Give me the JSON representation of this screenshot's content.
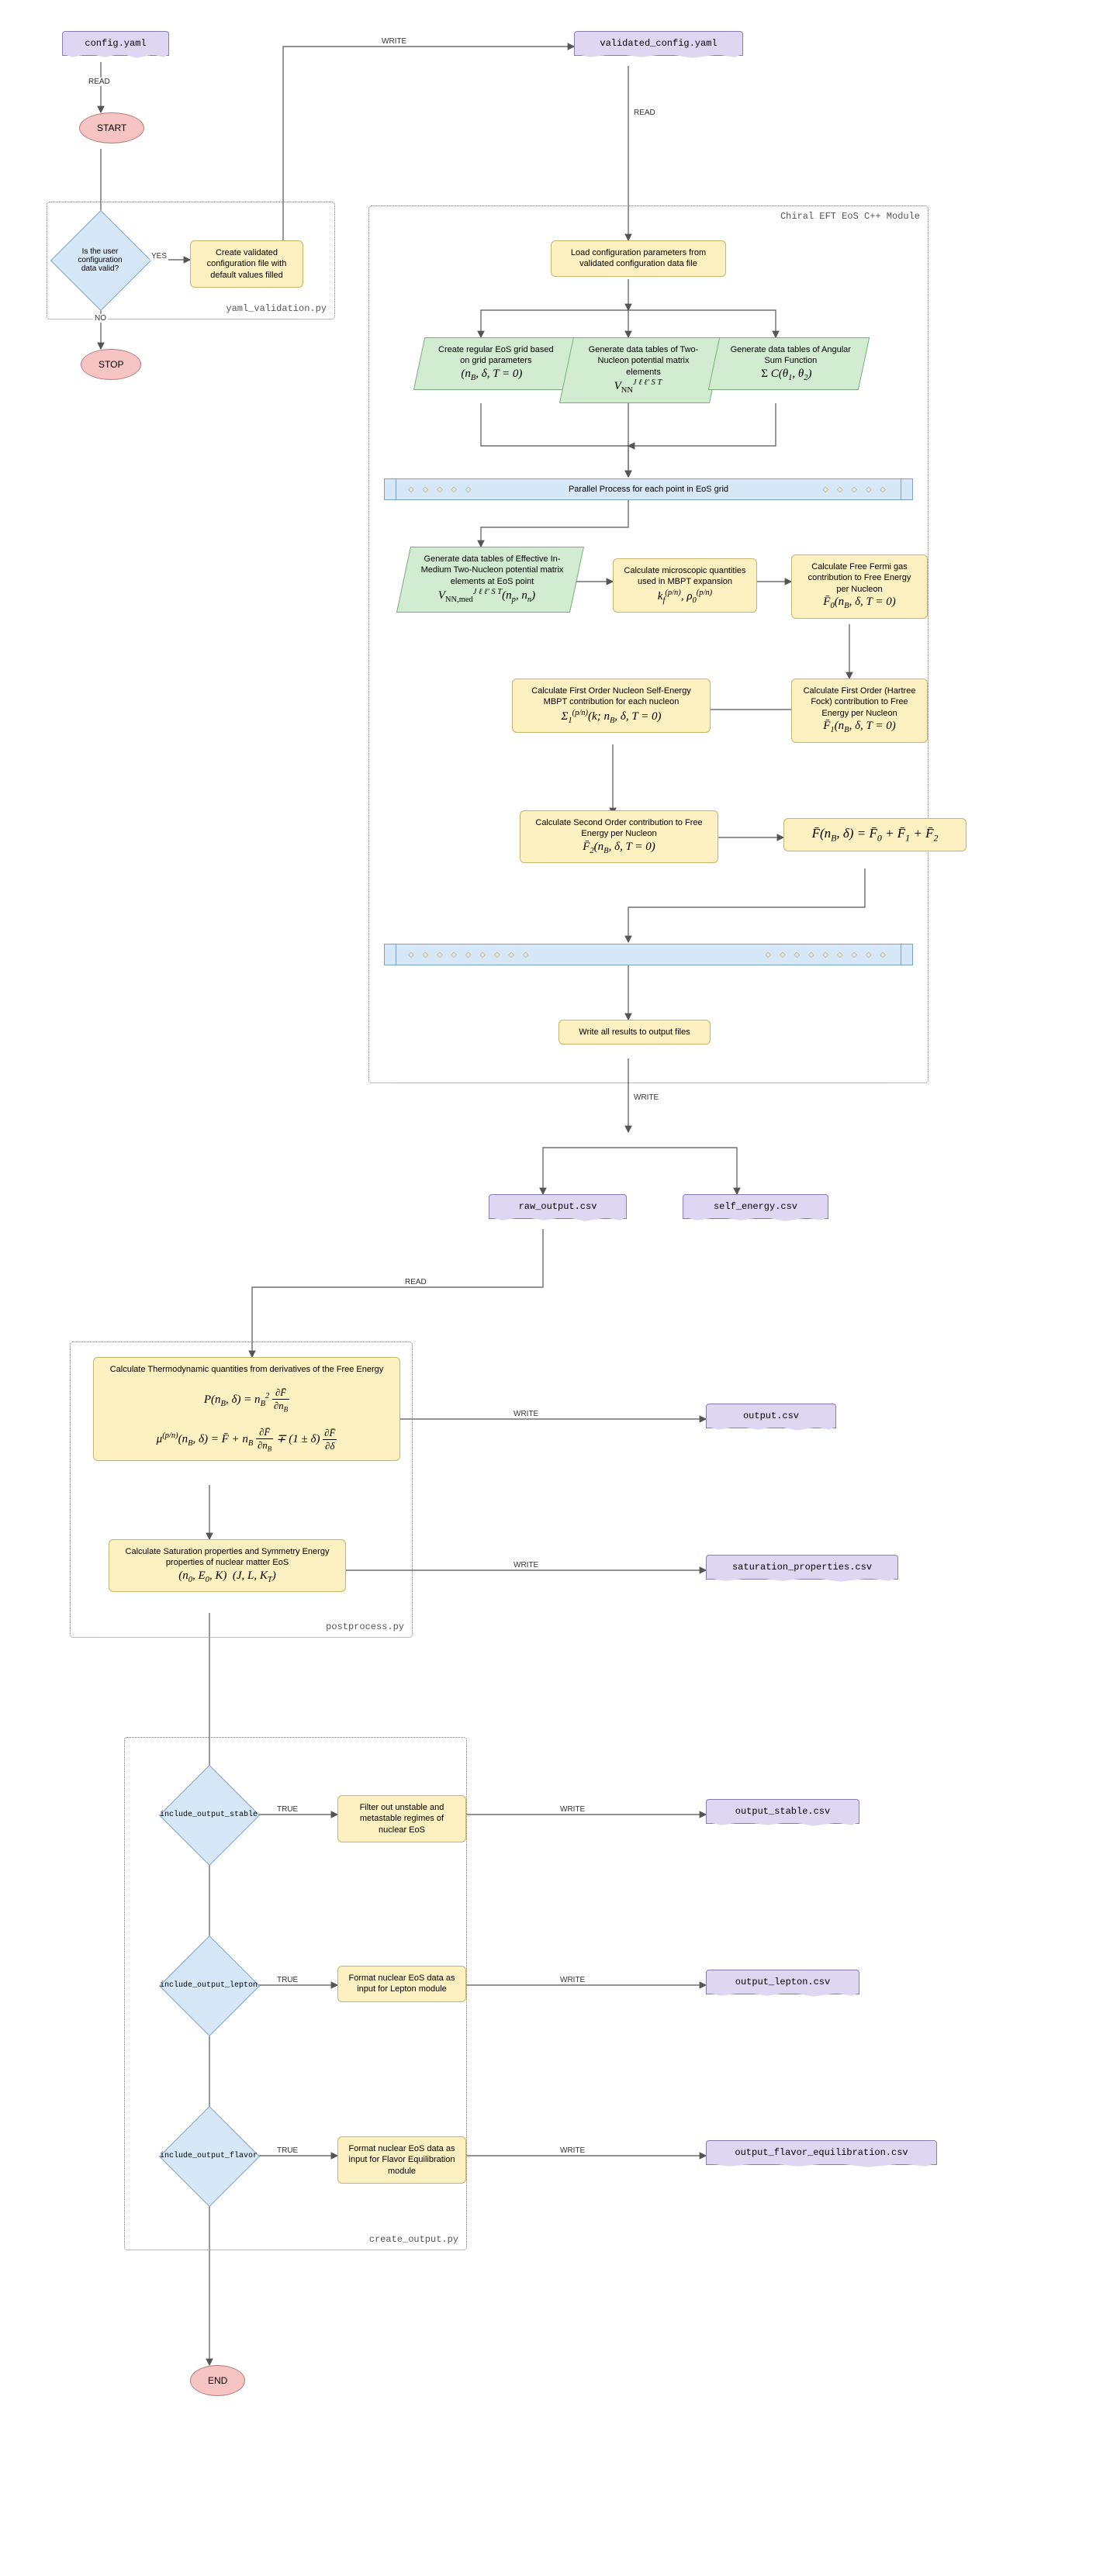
{
  "modules": {
    "yaml_validation": "yaml_validation.py",
    "chiral": "Chiral EFT EoS C++ Module",
    "postprocess": "postprocess.py",
    "create_output": "create_output.py"
  },
  "files": {
    "config": "config.yaml",
    "validated": "validated_config.yaml",
    "raw_output": "raw_output.csv",
    "self_energy": "self_energy.csv",
    "output": "output.csv",
    "saturation": "saturation_properties.csv",
    "output_stable": "output_stable.csv",
    "output_lepton": "output_lepton.csv",
    "output_flavor": "output_flavor_equilibration.csv"
  },
  "terminals": {
    "start": "START",
    "stop": "STOP",
    "end": "END"
  },
  "decisions": {
    "valid": "Is the user configuration data valid?",
    "inc_stable": "include_output_stable",
    "inc_lepton": "include_output_lepton",
    "inc_flavor": "include_output_flavor"
  },
  "processes": {
    "create_validated": "Create validated configuration file with default values filled",
    "load_config": "Load configuration parameters from validated configuration data file",
    "grid_text": "Create regular EoS grid based on grid parameters",
    "nn_text": "Generate data tables of Two-Nucleon potential matrix elements",
    "angular_text": "Generate data tables of Angular Sum Function",
    "effmed_text": "Generate data tables of Effective In-Medium Two-Nucleon potential matrix elements at EoS point",
    "micro_text": "Calculate microscopic quantities used in MBPT expansion",
    "f0_text": "Calculate Free Fermi gas contribution to Free Energy per Nucleon",
    "self_energy_text": "Calculate First Order Nucleon Self-Energy MBPT contribution for each nucleon",
    "f1_text": "Calculate First Order (Hartree Fock) contribution to Free Energy per Nucleon",
    "f2_text": "Calculate Second Order contribution to Free Energy per Nucleon",
    "write_results": "Write all results to output files",
    "thermo_text": "Calculate Thermodynamic quantities from derivatives of the Free Energy",
    "sat_text": "Calculate Saturation properties and Symmetry Energy properties of nuclear matter EoS",
    "filter_text": "Filter out unstable and metastable regimes of nuclear EoS",
    "lepton_text": "Format nuclear EoS data as input for Lepton module",
    "flavor_text": "Format nuclear EoS data as input for Flavor Equilibration module"
  },
  "parallel": {
    "bar_text": "Parallel Process for each point in EoS grid"
  },
  "edges": {
    "read": "READ",
    "write": "WRITE",
    "yes": "YES",
    "no": "NO",
    "true": "TRUE"
  },
  "formulas": {
    "grid": "(n_B, δ, T = 0)",
    "nn": "V_NN^{J ℓ ℓ' S T}",
    "angular": "Σ C(θ₁, θ₂)",
    "effmed": "V_{NN,med}^{J ℓ ℓ' S T}(n_p, n_n)",
    "micro": "k_f^{(p/n)}, ρ_0^{(p/n)}",
    "f0": "F̄₀(n_B, δ, T = 0)",
    "f1": "F̄₁(n_B, δ, T = 0)",
    "f2": "F̄₂(n_B, δ, T = 0)",
    "self_energy": "Σ₁^{(p/n)}(k; n_B, δ, T = 0)",
    "sum": "F̄(n_B, δ) = F̄₀ + F̄₁ + F̄₂",
    "pressure": "P(n_B, δ) = n_B² ∂F̄/∂n_B",
    "chem_pot": "μ^{(p/n)}(n_B, δ) = F̄ + n_B ∂F̄/∂n_B ∓ (1 ± δ) ∂F̄/∂δ",
    "sat": "(n₀, E₀, K)  (J, L, K_T)"
  },
  "chart_data": {
    "type": "flowchart",
    "description": "Computational pipeline: config validation → Chiral EFT EoS C++ module (parallel over EoS grid points, MBPT free-energy contributions F̄₀,F̄₁,F̄₂ and nucleon self-energy) → raw/self-energy CSV → postprocess (thermodynamic derivatives, saturation properties) → conditional output formatting (stable, lepton, flavor-equilibration).",
    "io_edges": [
      "READ",
      "WRITE"
    ],
    "branch_edges": [
      "YES",
      "NO",
      "TRUE"
    ]
  }
}
